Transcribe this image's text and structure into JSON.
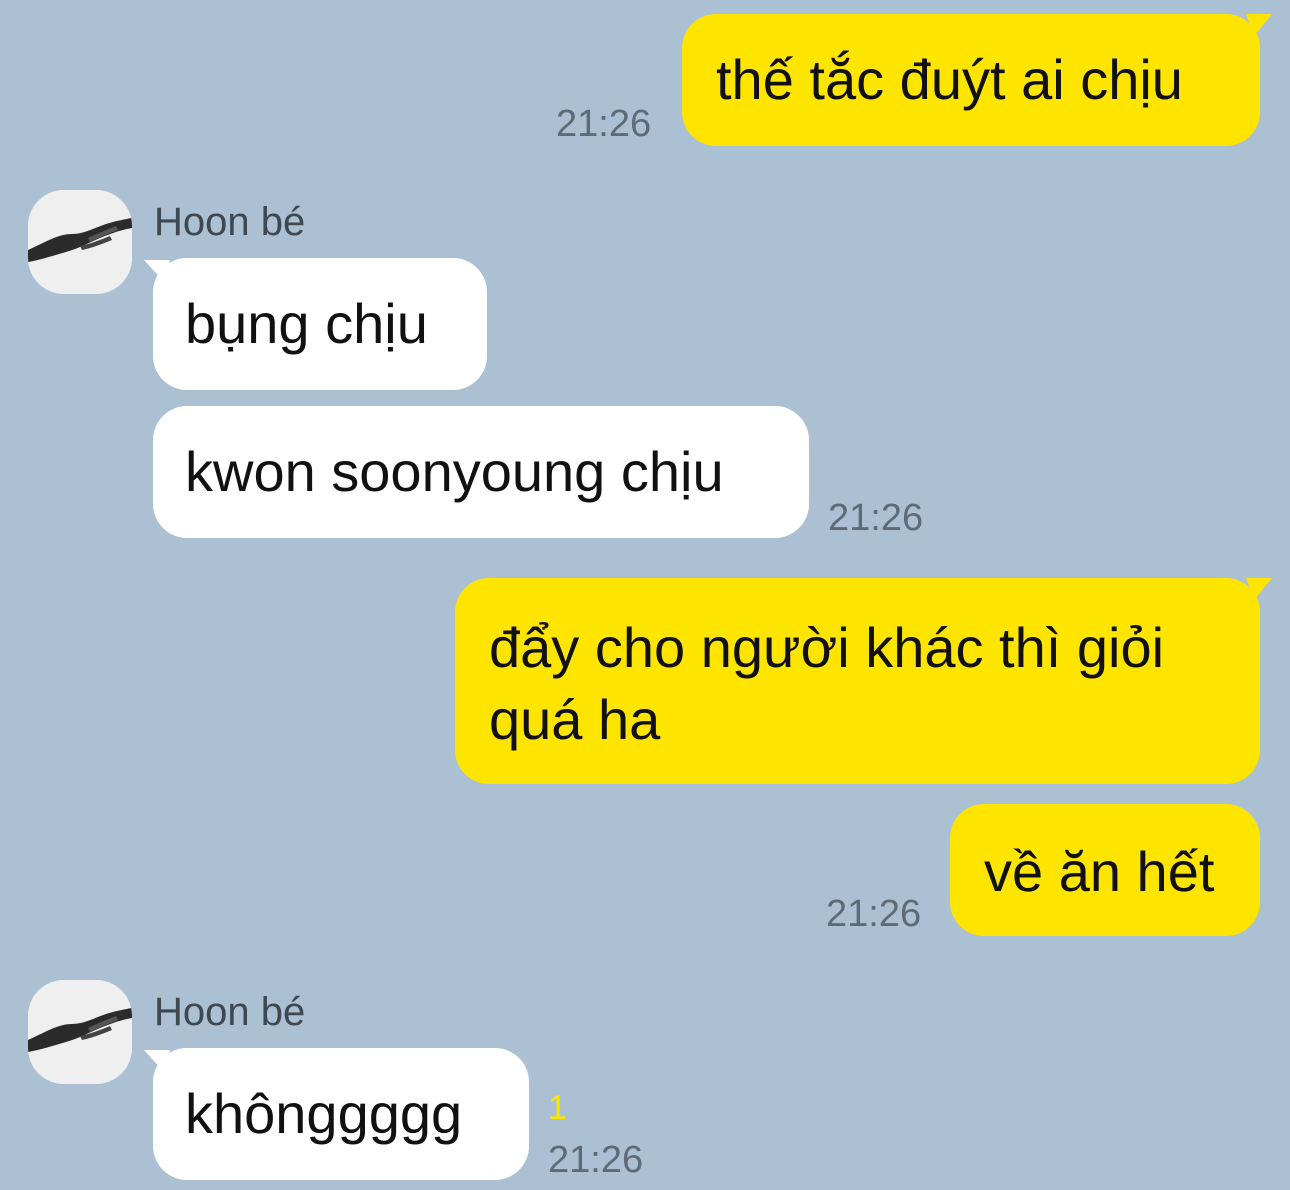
{
  "colors": {
    "background": "#abc1d3",
    "outgoing_bubble": "#fee500",
    "incoming_bubble": "#ffffff",
    "timestamp": "#5e6b77",
    "unread_count": "#fee500"
  },
  "messages": [
    {
      "direction": "outgoing",
      "text": "thế tắc đuýt ai chịu",
      "time": "21:26"
    },
    {
      "direction": "incoming",
      "sender": "Hoon bé",
      "avatar_icon": "hands-reaching-avatar-icon",
      "text": "bụng chịu"
    },
    {
      "direction": "incoming",
      "text": "kwon soonyoung chịu",
      "time": "21:26"
    },
    {
      "direction": "outgoing",
      "text_line1": "đẩy cho người khác thì giỏi",
      "text_line2": "quá ha"
    },
    {
      "direction": "outgoing",
      "text": "về ăn hết",
      "time": "21:26"
    },
    {
      "direction": "incoming",
      "sender": "Hoon bé",
      "avatar_icon": "hands-reaching-avatar-icon",
      "text": "khônggggg",
      "unread": "1",
      "time": "21:26"
    }
  ]
}
